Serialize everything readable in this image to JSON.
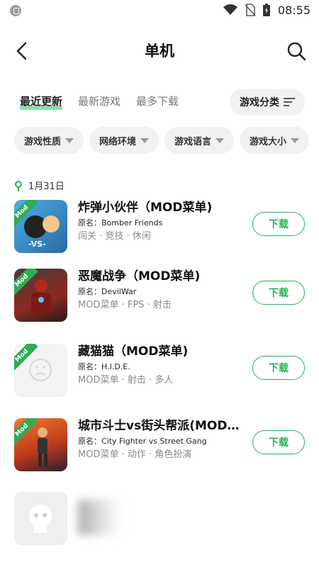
{
  "status_bar": {
    "time": "08:55"
  },
  "header": {
    "title": "单机"
  },
  "tabs": [
    {
      "label": "最近更新",
      "active": true
    },
    {
      "label": "最新游戏",
      "active": false
    },
    {
      "label": "最多下载",
      "active": false
    }
  ],
  "category_button": {
    "label": "游戏分类"
  },
  "filters": [
    {
      "label": "游戏性质"
    },
    {
      "label": "网络环境"
    },
    {
      "label": "游戏语言"
    },
    {
      "label": "游戏大小"
    }
  ],
  "date_label": "1月31日",
  "mod_badge": "Mod",
  "games": [
    {
      "name": "炸弹小伙伴（MOD菜单)",
      "original_name": "原名：Bomber Friends",
      "tags": "闯关 · 竞技 · 休闲",
      "download_label": "下载",
      "thumb_color": "#3b9ad8"
    },
    {
      "name": "恶魔战争（MOD菜单)",
      "original_name": "原名：DevilWar",
      "tags": "MOD菜单 · FPS · 射击",
      "download_label": "下载",
      "thumb_color": "#6b2a2a"
    },
    {
      "name": "藏猫猫（MOD菜单)",
      "original_name": "原名：H.I.D.E.",
      "tags": "MOD菜单 · 射击 · 多人",
      "download_label": "下载",
      "thumb_color": "#f3f3f3"
    },
    {
      "name": "城市斗士vs街头帮派(MOD…",
      "original_name": "原名：City Fighter vs Street Gang",
      "tags": "MOD菜单 · 动作 · 角色扮演",
      "download_label": "下载",
      "thumb_color": "#e05a2a"
    }
  ],
  "colors": {
    "accent": "#29b15a",
    "mod_tag": "#2faa55"
  }
}
